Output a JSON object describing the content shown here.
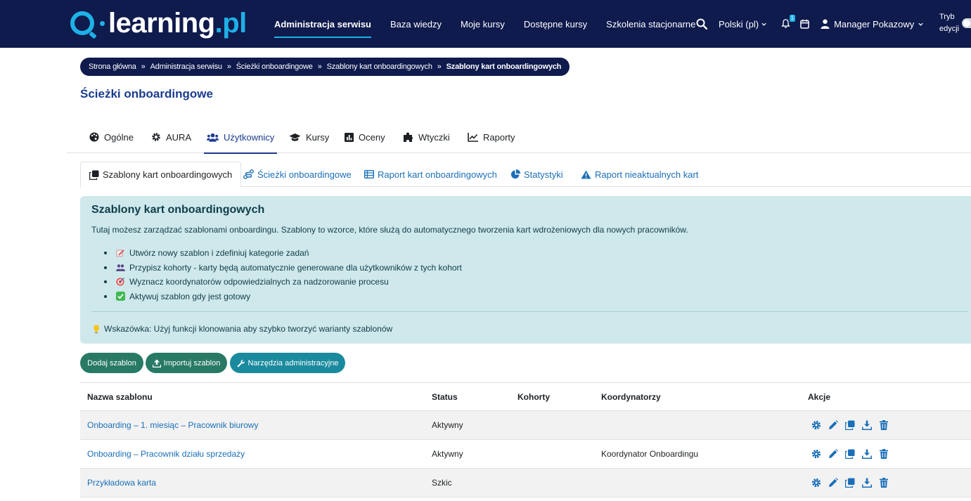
{
  "navbar": {
    "logo_text": "learning",
    "logo_suffix": ".pl",
    "links": [
      {
        "label": "Administracja serwisu",
        "active": true
      },
      {
        "label": "Baza wiedzy"
      },
      {
        "label": "Moje kursy"
      },
      {
        "label": "Dostępne kursy"
      },
      {
        "label": "Szkolenia stacjonarne"
      }
    ],
    "language": "Polski (pl)",
    "notification_count": "1",
    "user_name": "Manager Pokazowy",
    "edit_mode_line1": "Tryb",
    "edit_mode_line2": "edycji"
  },
  "breadcrumb": [
    "Strona główna",
    "Administracja serwisu",
    "Ścieżki onboardingowe",
    "Szablony kart onboardingowych",
    "Szablony kart onboardingowych"
  ],
  "page_title": "Ścieżki onboardingowe",
  "primary_tabs": [
    {
      "label": "Ogólne",
      "icon": "palette-icon"
    },
    {
      "label": "AURA",
      "icon": "gear-icon"
    },
    {
      "label": "Użytkownicy",
      "icon": "users-icon",
      "active": true
    },
    {
      "label": "Kursy",
      "icon": "graduation-cap-icon"
    },
    {
      "label": "Oceny",
      "icon": "chart-bar-icon"
    },
    {
      "label": "Wtyczki",
      "icon": "puzzle-icon"
    },
    {
      "label": "Raporty",
      "icon": "line-chart-icon"
    }
  ],
  "secondary_tabs": [
    {
      "label": "Szablony kart onboardingowych",
      "icon": "clone-icon",
      "active": true
    },
    {
      "label": "Ścieżki onboardingowe",
      "icon": "route-icon"
    },
    {
      "label": "Raport kart onboardingowych",
      "icon": "table-icon"
    },
    {
      "label": "Statystyki",
      "icon": "pie-chart-icon"
    },
    {
      "label": "Raport nieaktualnych kart",
      "icon": "warning-icon"
    }
  ],
  "info": {
    "title": "Szablony kart onboardingowych",
    "lead": "Tutaj możesz zarządzać szablonami onboardingu. Szablony to wzorce, które służą do automatycznego tworzenia kart wdrożeniowych dla nowych pracowników.",
    "items": [
      {
        "text": "Utwórz nowy szablon i zdefiniuj kategorie zadań",
        "icon": "memo-icon"
      },
      {
        "text": "Przypisz kohorty - karty będą automatycznie generowane dla użytkowników z tych kohort",
        "icon": "people-icon"
      },
      {
        "text": "Wyznacz koordynatorów odpowiedzialnych za nadzorowanie procesu",
        "icon": "target-icon"
      },
      {
        "text": "Aktywuj szablon gdy jest gotowy",
        "icon": "check-box-icon"
      }
    ],
    "tip": "Wskazówka: Użyj funkcji klonowania aby szybko tworzyć warianty szablonów"
  },
  "buttons": {
    "add": "Dodaj szablon",
    "import": "Importuj szablon",
    "tools": "Narzędzia administracyjne"
  },
  "table": {
    "headers": {
      "name": "Nazwa szablonu",
      "status": "Status",
      "cohorts": "Kohorty",
      "coordinators": "Koordynatorzy",
      "actions": "Akcje"
    },
    "rows": [
      {
        "name": "Onboarding – 1. miesiąc – Pracownik biurowy",
        "status": "Aktywny",
        "cohorts": "",
        "coordinators": ""
      },
      {
        "name": "Onboarding – Pracownik działu sprzedaży",
        "status": "Aktywny",
        "cohorts": "",
        "coordinators": "Koordynator Onboardingu"
      },
      {
        "name": "Przykładowa karta",
        "status": "Szkic",
        "cohorts": "",
        "coordinators": ""
      }
    ]
  },
  "colors": {
    "navbar": "#0f1a4d",
    "accent": "#1eb1e6",
    "link": "#1a6fb8",
    "info_bg": "#cfe8eb",
    "button_green": "#287a65",
    "button_teal": "#1a8a9e"
  }
}
